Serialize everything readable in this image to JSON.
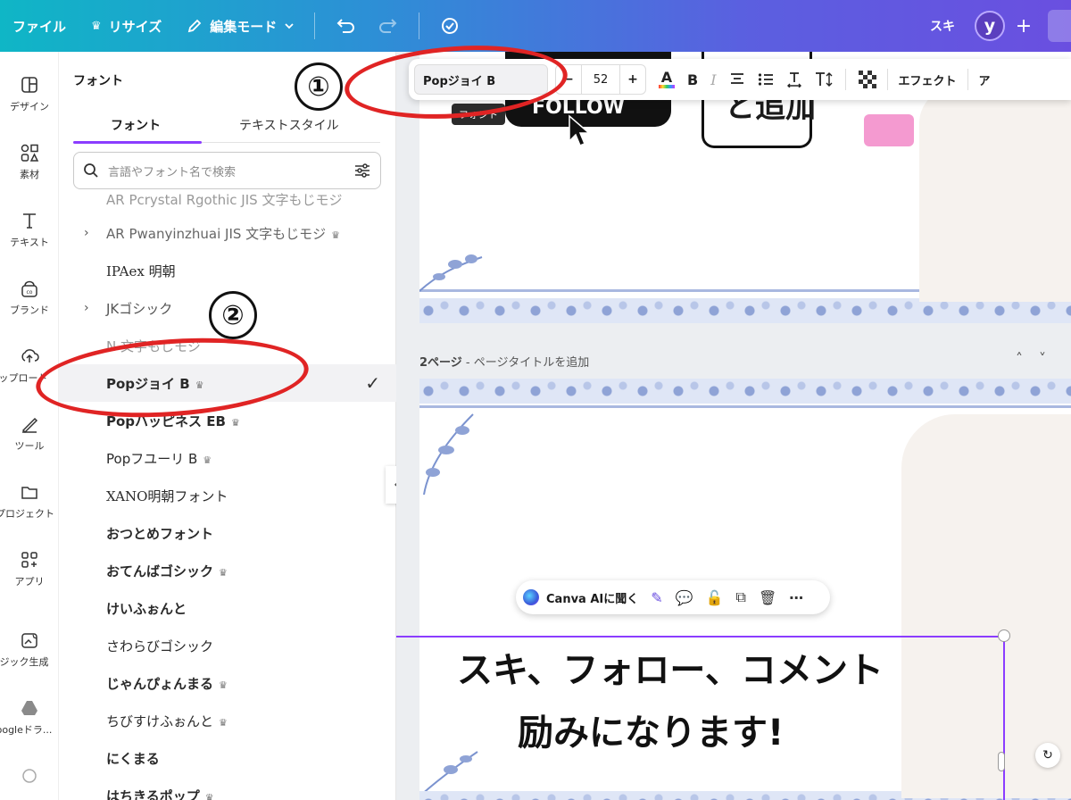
{
  "topbar": {
    "file": "ファイル",
    "resize": "リサイズ",
    "edit_mode": "編集モード",
    "right_label": "スキ",
    "avatar": "y",
    "plus": "+",
    "colors": {
      "start": "#0fb6c6",
      "end": "#6a4fe0"
    }
  },
  "rail": {
    "items": [
      {
        "label": "デザイン",
        "icon": "design-icon"
      },
      {
        "label": "素材",
        "icon": "elements-icon"
      },
      {
        "label": "テキスト",
        "icon": "text-icon"
      },
      {
        "label": "ブランド",
        "icon": "brand-icon"
      },
      {
        "label": "ップロード",
        "icon": "upload-icon"
      },
      {
        "label": "ツール",
        "icon": "tools-icon"
      },
      {
        "label": "プロジェクト",
        "icon": "projects-icon"
      },
      {
        "label": "アプリ",
        "icon": "apps-icon"
      },
      {
        "label": "ジック生成",
        "icon": "magic-media-icon"
      },
      {
        "label": "oogleドラ...",
        "icon": "google-drive-icon"
      }
    ]
  },
  "panel": {
    "title": "フォント",
    "tabs": [
      "フォント",
      "テキストスタイル"
    ],
    "search_placeholder": "言語やフォント名で検索",
    "fonts": [
      {
        "name": "AR Pcrystal Rgothic JIS 文字もじモジ",
        "chevron": false,
        "crown": false,
        "bold": false
      },
      {
        "name": "AR Pwanyinzhuai JIS 文字もじモジ",
        "chevron": true,
        "crown": true,
        "bold": false
      },
      {
        "name": "IPAex 明朝",
        "chevron": false,
        "crown": false,
        "bold": false
      },
      {
        "name": "JKゴシック",
        "chevron": true,
        "crown": false,
        "bold": false
      },
      {
        "name": "N          文字もじモジ",
        "chevron": false,
        "crown": false,
        "bold": false
      },
      {
        "name": "Popジョイ B",
        "chevron": false,
        "crown": true,
        "bold": true,
        "selected": true
      },
      {
        "name": "Popハッピネス EB",
        "chevron": false,
        "crown": true,
        "bold": true
      },
      {
        "name": "Popフユーリ B",
        "chevron": false,
        "crown": true,
        "bold": false
      },
      {
        "name": "XANO明朝フォント",
        "chevron": false,
        "crown": false,
        "bold": false
      },
      {
        "name": "おつとめフォント",
        "chevron": false,
        "crown": false,
        "bold": true
      },
      {
        "name": "おてんばゴシック",
        "chevron": false,
        "crown": true,
        "bold": true
      },
      {
        "name": "けいふぉんと",
        "chevron": false,
        "crown": false,
        "bold": true
      },
      {
        "name": "さわらびゴシック",
        "chevron": false,
        "crown": false,
        "bold": false
      },
      {
        "name": "じゃんぴょんまる",
        "chevron": false,
        "crown": true,
        "bold": true
      },
      {
        "name": "ちびすけふぉんと",
        "chevron": false,
        "crown": true,
        "bold": false
      },
      {
        "name": "にくまる",
        "chevron": false,
        "crown": false,
        "bold": true
      },
      {
        "name": "はちきるポップ",
        "chevron": false,
        "crown": true,
        "bold": true
      }
    ],
    "crown_glyph": "♛",
    "check_glyph": "✓"
  },
  "toolbar": {
    "font_name": "Popジョイ B",
    "size_minus": "−",
    "size": "52",
    "size_plus": "+",
    "bold": "B",
    "italic": "I",
    "effect": "エフェクト",
    "tail": "ア",
    "tooltip": "フォント"
  },
  "annotations": {
    "one": "①",
    "two": "②",
    "accent": "#e02424"
  },
  "canvas": {
    "page2_label_bold": "2ページ",
    "page2_label_rest": " - ページタイトルを追加",
    "page1_fragment": "と追加",
    "black_button_fragment": "FOLLOW",
    "headline_line1": "スキ、フォロー、コメント",
    "headline_line2": "励みになります!",
    "ai_label": "Canva AIに聞く",
    "selection_color": "#8b3dff"
  }
}
